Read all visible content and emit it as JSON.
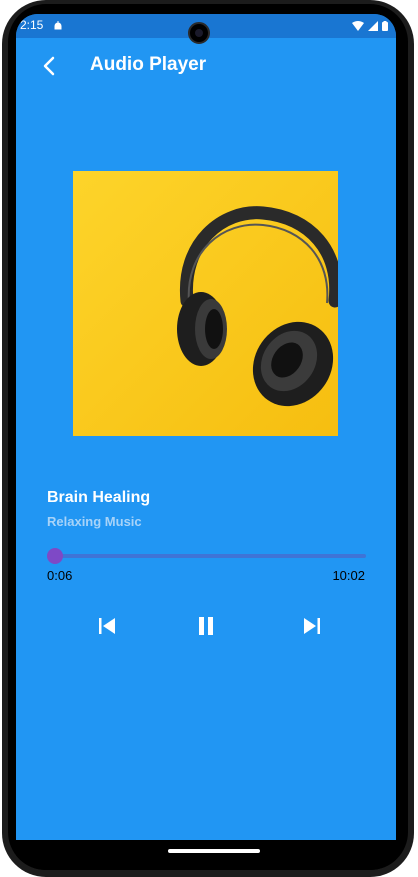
{
  "status_bar": {
    "time": "2:15",
    "icons": [
      "notification-icon",
      "wifi-icon",
      "signal-icon",
      "battery-icon"
    ]
  },
  "app_bar": {
    "title": "Audio Player",
    "back_icon": "back-arrow-icon"
  },
  "track": {
    "title": "Brain Healing",
    "subtitle": "Relaxing Music",
    "album_art": "headphones-on-yellow"
  },
  "playback": {
    "current_time": "0:06",
    "total_time": "10:02",
    "progress_fraction": 0.01
  },
  "controls": {
    "previous_icon": "skip-previous-icon",
    "play_pause_icon": "pause-icon",
    "next_icon": "skip-next-icon"
  },
  "colors": {
    "background": "#2196F3",
    "status_bar": "#1976D2",
    "slider_active": "#7E49C6",
    "slider_track": "#3F74D6",
    "album_background": "#FCCB1C"
  }
}
